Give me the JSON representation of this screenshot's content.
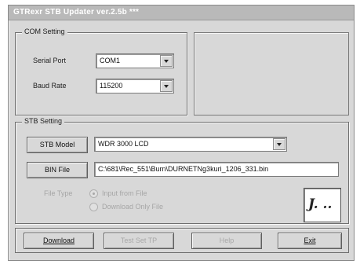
{
  "window": {
    "title": "GTRexr STB Updater ver.2.5b ***"
  },
  "com_setting": {
    "legend": "COM Setting",
    "serial_port_label": "Serial Port",
    "serial_port_value": "COM1",
    "baud_rate_label": "Baud Rate",
    "baud_rate_value": "115200"
  },
  "stb_setting": {
    "legend": "STB Setting",
    "stb_model_button": "STB Model",
    "stb_model_value": "WDR 3000 LCD",
    "bin_file_button": "BIN File",
    "bin_file_value": "C:\\681\\Rec_551\\Burn\\DURNETNg3kuri_1206_331.bin",
    "file_type_label": "File Type",
    "radio_1_label": "Input from File",
    "radio_2_label": "Download Only File",
    "signature_text": "J. ..",
    "signature_icon": "signature-icon"
  },
  "buttons": {
    "download": "Download",
    "test": "Test Set TP",
    "help": "Help",
    "exit": "Exit"
  },
  "colors": {
    "window_bg": "#d8d8d8",
    "titlebar_bg": "#b9b9b9",
    "disabled_text": "#a8a8a8"
  }
}
